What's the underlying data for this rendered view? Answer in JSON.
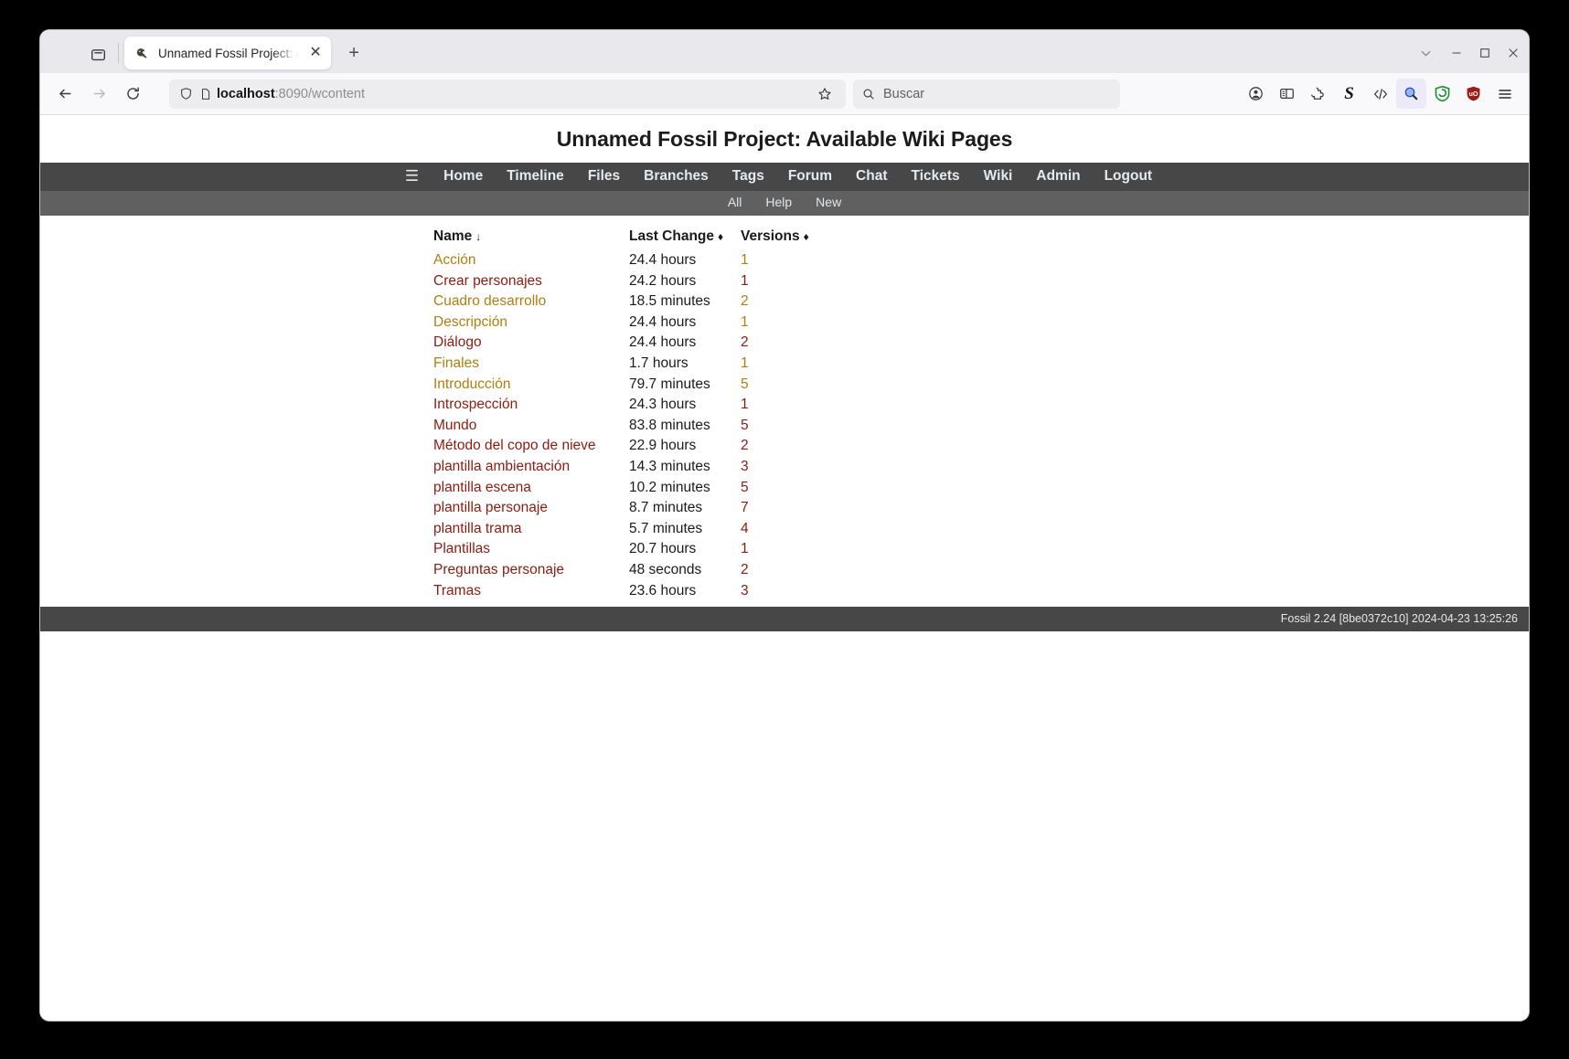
{
  "browser": {
    "tab": {
      "title": "Unnamed Fossil Project: A",
      "favicon_name": "fossil-favicon",
      "close_label": "✕"
    },
    "new_tab_label": "+",
    "window_controls": {
      "chevron": "⌄",
      "minimize": "—",
      "maximize": "☐",
      "close": "✕"
    },
    "nav": {
      "back_label": "←",
      "forward_label": "→",
      "reload_label": "↻"
    },
    "url": {
      "host": "localhost",
      "path": ":8090/wcontent",
      "full": "localhost:8090/wcontent"
    },
    "search": {
      "placeholder": "Buscar"
    },
    "extensions": [
      "account-icon",
      "sidebar-icon",
      "extension-puzzle-icon",
      "stylus-s-icon",
      "code-brackets-icon",
      "search-magnifier-icon",
      "privacy-badger-icon",
      "ublock-origin-icon",
      "app-menu-icon"
    ]
  },
  "page": {
    "title": "Unnamed Fossil Project: Available Wiki Pages",
    "mainmenu": {
      "hamburger": "☰",
      "items": [
        "Home",
        "Timeline",
        "Files",
        "Branches",
        "Tags",
        "Forum",
        "Chat",
        "Tickets",
        "Wiki",
        "Admin",
        "Logout"
      ]
    },
    "submenu": {
      "items": [
        "All",
        "Help",
        "New"
      ]
    },
    "table": {
      "headers": [
        {
          "label": "Name",
          "sortmark": "↓"
        },
        {
          "label": "Last Change",
          "sortmark": "♦"
        },
        {
          "label": "Versions",
          "sortmark": "♦"
        }
      ],
      "rows": [
        {
          "name": "Acción",
          "color": "orange",
          "change": "24.4 hours",
          "versions": "1"
        },
        {
          "name": "Crear personajes",
          "color": "maroon",
          "change": "24.2 hours",
          "versions": "1"
        },
        {
          "name": "Cuadro desarrollo",
          "color": "orange",
          "change": "18.5 minutes",
          "versions": "2"
        },
        {
          "name": "Descripción",
          "color": "orange",
          "change": "24.4 hours",
          "versions": "1"
        },
        {
          "name": "Diálogo",
          "color": "maroon",
          "change": "24.4 hours",
          "versions": "2"
        },
        {
          "name": "Finales",
          "color": "orange",
          "change": "1.7 hours",
          "versions": "1"
        },
        {
          "name": "Introducción",
          "color": "orange",
          "change": "79.7 minutes",
          "versions": "5"
        },
        {
          "name": "Introspección",
          "color": "maroon",
          "change": "24.3 hours",
          "versions": "1"
        },
        {
          "name": "Mundo",
          "color": "maroon",
          "change": "83.8 minutes",
          "versions": "5"
        },
        {
          "name": "Método del copo de nieve",
          "color": "maroon",
          "change": "22.9 hours",
          "versions": "2"
        },
        {
          "name": "plantilla ambientación",
          "color": "maroon",
          "change": "14.3 minutes",
          "versions": "3"
        },
        {
          "name": "plantilla escena",
          "color": "maroon",
          "change": "10.2 minutes",
          "versions": "5"
        },
        {
          "name": "plantilla personaje",
          "color": "maroon",
          "change": "8.7 minutes",
          "versions": "7"
        },
        {
          "name": "plantilla trama",
          "color": "maroon",
          "change": "5.7 minutes",
          "versions": "4"
        },
        {
          "name": "Plantillas",
          "color": "maroon",
          "change": "20.7 hours",
          "versions": "1"
        },
        {
          "name": "Preguntas personaje",
          "color": "maroon",
          "change": "48 seconds",
          "versions": "2"
        },
        {
          "name": "Tramas",
          "color": "maroon",
          "change": "23.6 hours",
          "versions": "3"
        }
      ]
    },
    "footer": "Fossil 2.24 [8be0372c10] 2024-04-23 13:25:26"
  },
  "colors": {
    "menu_bg": "#474747",
    "submenu_bg": "#606060",
    "link_orange": "#b07d10",
    "link_maroon": "#8c1b10"
  }
}
